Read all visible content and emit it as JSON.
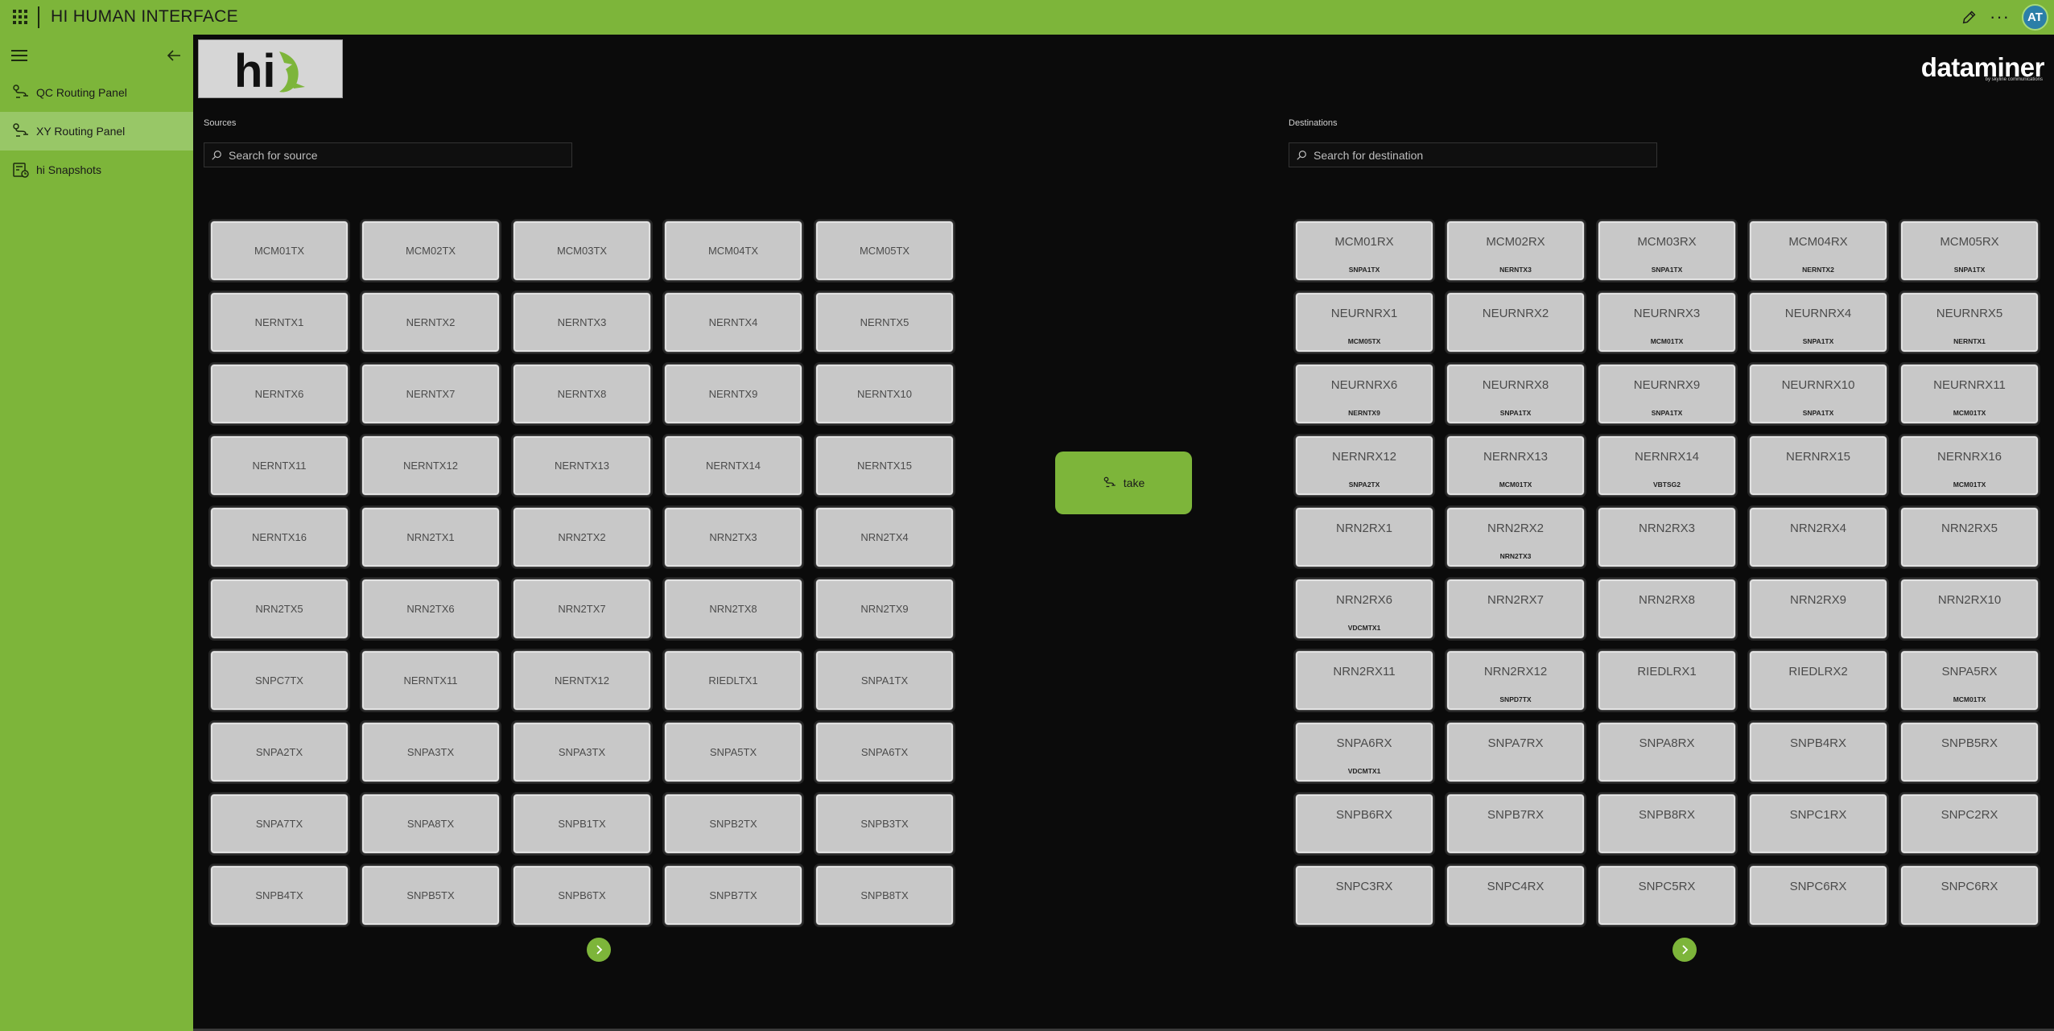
{
  "app": {
    "title": "HI HUMAN INTERFACE",
    "user_initials": "AT"
  },
  "colors": {
    "accent": "#7db53a",
    "active_nav": "#98c767",
    "background": "#0b0b0b",
    "tile": "#c8c8c8"
  },
  "sidebar": {
    "items": [
      {
        "label": "QC Routing Panel",
        "icon": "route-icon",
        "active": false
      },
      {
        "label": "XY Routing Panel",
        "icon": "route-icon",
        "active": true
      },
      {
        "label": "hi Snapshots",
        "icon": "snapshot-icon",
        "active": false
      }
    ]
  },
  "logo": {
    "text": "hi"
  },
  "brand": {
    "name": "dataminer",
    "tagline": "by skyline communications"
  },
  "sources": {
    "label": "Sources",
    "search_placeholder": "Search for source",
    "tiles": [
      "MCM01TX",
      "MCM02TX",
      "MCM03TX",
      "MCM04TX",
      "MCM05TX",
      "NERNTX1",
      "NERNTX2",
      "NERNTX3",
      "NERNTX4",
      "NERNTX5",
      "NERNTX6",
      "NERNTX7",
      "NERNTX8",
      "NERNTX9",
      "NERNTX10",
      "NERNTX11",
      "NERNTX12",
      "NERNTX13",
      "NERNTX14",
      "NERNTX15",
      "NERNTX16",
      "NRN2TX1",
      "NRN2TX2",
      "NRN2TX3",
      "NRN2TX4",
      "NRN2TX5",
      "NRN2TX6",
      "NRN2TX7",
      "NRN2TX8",
      "NRN2TX9",
      "SNPC7TX",
      "NERNTX11",
      "NERNTX12",
      "RIEDLTX1",
      "SNPA1TX",
      "SNPA2TX",
      "SNPA3TX",
      "SNPA3TX",
      "SNPA5TX",
      "SNPA6TX",
      "SNPA7TX",
      "SNPA8TX",
      "SNPB1TX",
      "SNPB2TX",
      "SNPB3TX",
      "SNPB4TX",
      "SNPB5TX",
      "SNPB6TX",
      "SNPB7TX",
      "SNPB8TX"
    ]
  },
  "destinations": {
    "label": "Destinations",
    "search_placeholder": "Search for destination",
    "tiles": [
      {
        "name": "MCM01RX",
        "source": "SNPA1TX"
      },
      {
        "name": "MCM02RX",
        "source": "NERNTX3"
      },
      {
        "name": "MCM03RX",
        "source": "SNPA1TX"
      },
      {
        "name": "MCM04RX",
        "source": "NERNTX2"
      },
      {
        "name": "MCM05RX",
        "source": "SNPA1TX"
      },
      {
        "name": "NEURNRX1",
        "source": "MCM05TX"
      },
      {
        "name": "NEURNRX2",
        "source": ""
      },
      {
        "name": "NEURNRX3",
        "source": "MCM01TX"
      },
      {
        "name": "NEURNRX4",
        "source": "SNPA1TX"
      },
      {
        "name": "NEURNRX5",
        "source": "NERNTX1"
      },
      {
        "name": "NEURNRX6",
        "source": "NERNTX9"
      },
      {
        "name": "NEURNRX8",
        "source": "SNPA1TX"
      },
      {
        "name": "NEURNRX9",
        "source": "SNPA1TX"
      },
      {
        "name": "NEURNRX10",
        "source": "SNPA1TX"
      },
      {
        "name": "NEURNRX11",
        "source": "MCM01TX"
      },
      {
        "name": "NERNRX12",
        "source": "SNPA2TX"
      },
      {
        "name": "NERNRX13",
        "source": "MCM01TX"
      },
      {
        "name": "NERNRX14",
        "source": "VBTSG2"
      },
      {
        "name": "NERNRX15",
        "source": ""
      },
      {
        "name": "NERNRX16",
        "source": "MCM01TX"
      },
      {
        "name": "NRN2RX1",
        "source": ""
      },
      {
        "name": "NRN2RX2",
        "source": "NRN2TX3"
      },
      {
        "name": "NRN2RX3",
        "source": ""
      },
      {
        "name": "NRN2RX4",
        "source": ""
      },
      {
        "name": "NRN2RX5",
        "source": ""
      },
      {
        "name": "NRN2RX6",
        "source": "VDCMTX1"
      },
      {
        "name": "NRN2RX7",
        "source": ""
      },
      {
        "name": "NRN2RX8",
        "source": ""
      },
      {
        "name": "NRN2RX9",
        "source": ""
      },
      {
        "name": "NRN2RX10",
        "source": ""
      },
      {
        "name": "NRN2RX11",
        "source": ""
      },
      {
        "name": "NRN2RX12",
        "source": "SNPD7TX"
      },
      {
        "name": "RIEDLRX1",
        "source": ""
      },
      {
        "name": "RIEDLRX2",
        "source": ""
      },
      {
        "name": "SNPA5RX",
        "source": "MCM01TX"
      },
      {
        "name": "SNPA6RX",
        "source": "VDCMTX1"
      },
      {
        "name": "SNPA7RX",
        "source": ""
      },
      {
        "name": "SNPA8RX",
        "source": ""
      },
      {
        "name": "SNPB4RX",
        "source": ""
      },
      {
        "name": "SNPB5RX",
        "source": ""
      },
      {
        "name": "SNPB6RX",
        "source": ""
      },
      {
        "name": "SNPB7RX",
        "source": ""
      },
      {
        "name": "SNPB8RX",
        "source": ""
      },
      {
        "name": "SNPC1RX",
        "source": ""
      },
      {
        "name": "SNPC2RX",
        "source": ""
      },
      {
        "name": "SNPC3RX",
        "source": ""
      },
      {
        "name": "SNPC4RX",
        "source": ""
      },
      {
        "name": "SNPC5RX",
        "source": ""
      },
      {
        "name": "SNPC6RX",
        "source": ""
      },
      {
        "name": "SNPC6RX",
        "source": ""
      }
    ]
  },
  "take_button": {
    "label": "take"
  }
}
